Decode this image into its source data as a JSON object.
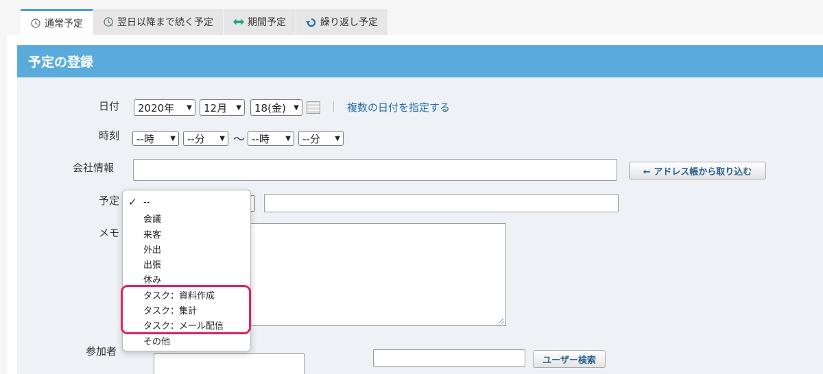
{
  "tabs": [
    {
      "label": "通常予定",
      "icon": "clock-icon"
    },
    {
      "label": "翌日以降まで続く予定",
      "icon": "clock-arrow-icon"
    },
    {
      "label": "期間予定",
      "icon": "double-arrow-icon"
    },
    {
      "label": "繰り返し予定",
      "icon": "repeat-icon"
    }
  ],
  "header": {
    "title": "予定の登録"
  },
  "form": {
    "date_label": "日付",
    "year": "2020年",
    "month": "12月",
    "day": "18(金)",
    "multi_date_link": "複数の日付を指定する",
    "time_label": "時刻",
    "start_hour": "--時",
    "start_min": "--分",
    "tilde": "〜",
    "end_hour": "--時",
    "end_min": "--分",
    "company_label": "会社情報",
    "address_button": "← アドレス帳から取り込む",
    "schedule_label": "予定",
    "memo_label": "メモ",
    "participants_label": "参加者",
    "user_search_button": "ユーザー検索"
  },
  "dropdown": {
    "options": [
      "--",
      "会議",
      "来客",
      "外出",
      "出張",
      "休み",
      "タスク：資料作成",
      "タスク：集計",
      "タスク：メール配信",
      "その他"
    ],
    "selected": "--"
  },
  "colors": {
    "header": "#5aabdc",
    "highlight": "#e0245e",
    "link": "#1f6aa8"
  }
}
